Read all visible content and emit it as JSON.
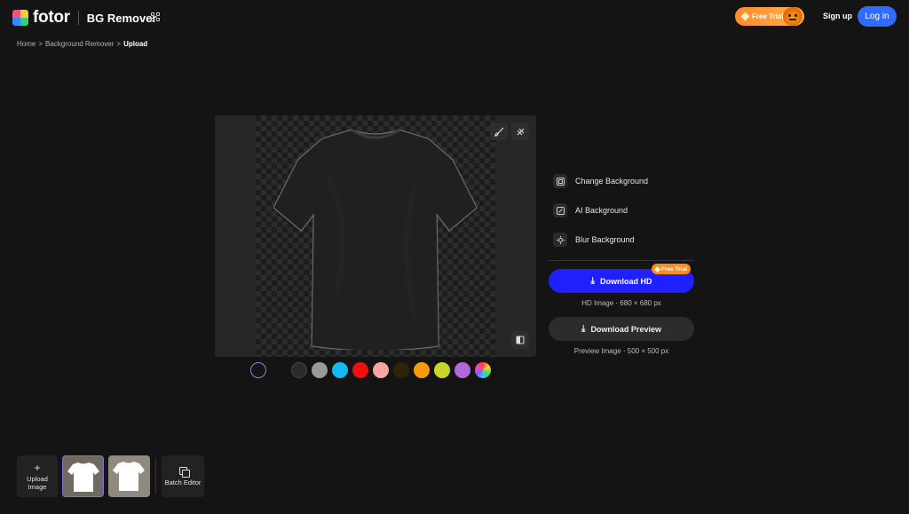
{
  "header": {
    "logo_text": "fotor",
    "product_name": "BG Remover",
    "free_trial_label": "Free Trial",
    "signup_label": "Sign up",
    "login_label": "Log in"
  },
  "breadcrumb": {
    "items": [
      "Home",
      ">",
      "Background Remover",
      ">",
      "Upload"
    ]
  },
  "canvas": {
    "tools": [
      "brush-icon",
      "eraser-icon",
      "compare-icon"
    ]
  },
  "swatches": [
    "transparent",
    "#141414",
    "#2b2b2b",
    "#9a9a9a",
    "#14b9ef",
    "#ee0f10",
    "#f6a5a5",
    "#2d2408",
    "#f79a0f",
    "#c8d62a",
    "#b06ad9",
    "gradient"
  ],
  "side_panel": {
    "items": [
      {
        "label": "Change Background",
        "icon": "change-background-icon"
      },
      {
        "label": "AI Background",
        "icon": "ai-background-icon"
      },
      {
        "label": "Blur Background",
        "icon": "blur-background-icon"
      }
    ],
    "download_hd": {
      "label": "Download HD",
      "badge": "Free Trial",
      "info": "HD Image · 680 × 680 px"
    },
    "download_preview": {
      "label": "Download Preview",
      "info": "Preview Image · 500 × 500 px"
    }
  },
  "tray": {
    "upload_label_1": "Upload",
    "upload_label_2": "Image",
    "batch_label": "Batch Editor"
  },
  "colors": {
    "accent_blue": "#2020ff",
    "login_blue": "#2f6bff",
    "trial_orange": "#ff8c1a"
  }
}
